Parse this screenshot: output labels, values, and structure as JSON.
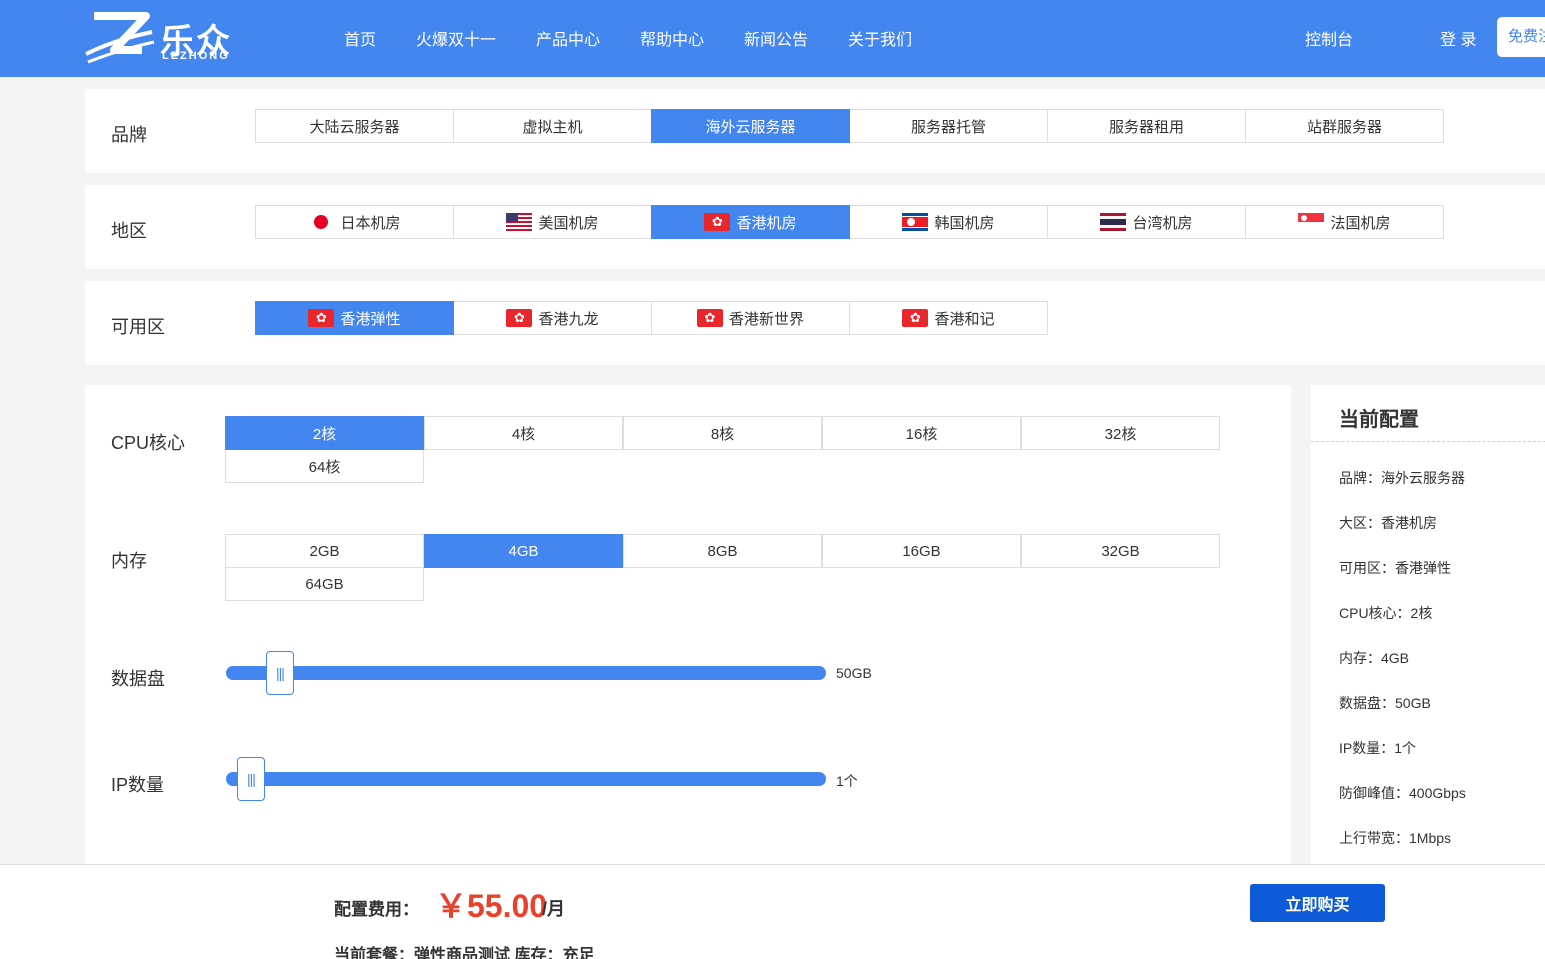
{
  "header": {
    "logo_cn": "乐众",
    "logo_en": "LEZHONG",
    "nav": [
      "首页",
      "火爆双十一",
      "产品中心",
      "帮助中心",
      "新闻公告",
      "关于我们"
    ],
    "console": "控制台",
    "login": "登 录",
    "free_register": "免费注册"
  },
  "brand": {
    "label": "品牌",
    "options": [
      "大陆云服务器",
      "虚拟主机",
      "海外云服务器",
      "服务器托管",
      "服务器租用",
      "站群服务器"
    ],
    "selected": 2
  },
  "region": {
    "label": "地区",
    "options": [
      {
        "name": "日本机房",
        "flag": "japan-flag-icon"
      },
      {
        "name": "美国机房",
        "flag": "usa-flag-icon"
      },
      {
        "name": "香港机房",
        "flag": "hongkong-flag-icon"
      },
      {
        "name": "韩国机房",
        "flag": "korea-flag-icon"
      },
      {
        "name": "台湾机房",
        "flag": "thailand-flag-icon"
      },
      {
        "name": "法国机房",
        "flag": "singapore-flag-icon"
      }
    ],
    "selected": 2
  },
  "zone": {
    "label": "可用区",
    "options": [
      "香港弹性",
      "香港九龙",
      "香港新世界",
      "香港和记"
    ],
    "selected": 0
  },
  "cpu": {
    "label": "CPU核心",
    "options": [
      "2核",
      "4核",
      "8核",
      "16核",
      "32核",
      "64核"
    ],
    "selected": 0
  },
  "memory": {
    "label": "内存",
    "options": [
      "2GB",
      "4GB",
      "8GB",
      "16GB",
      "32GB",
      "64GB"
    ],
    "selected": 1
  },
  "disk": {
    "label": "数据盘",
    "value_text": "50GB",
    "fraction": 0.07
  },
  "ip": {
    "label": "IP数量",
    "value_text": "1个",
    "fraction": 0.02
  },
  "sidebar": {
    "title": "当前配置",
    "items": [
      "品牌：海外云服务器",
      "大区：香港机房",
      "可用区：香港弹性",
      "CPU核心：2核",
      "内存：4GB",
      "数据盘：50GB",
      "IP数量：1个",
      "防御峰值：400Gbps",
      "上行带宽：1Mbps"
    ]
  },
  "footer": {
    "price_label": "配置费用：",
    "price": "￥55.00",
    "price_unit": "/月",
    "package": "当前套餐：弹性商品测试 库存：充足",
    "buy_button": "立即购买"
  },
  "colors": {
    "primary": "#4386f0",
    "price": "#e8412c",
    "buy_button": "#0f5ad8"
  }
}
